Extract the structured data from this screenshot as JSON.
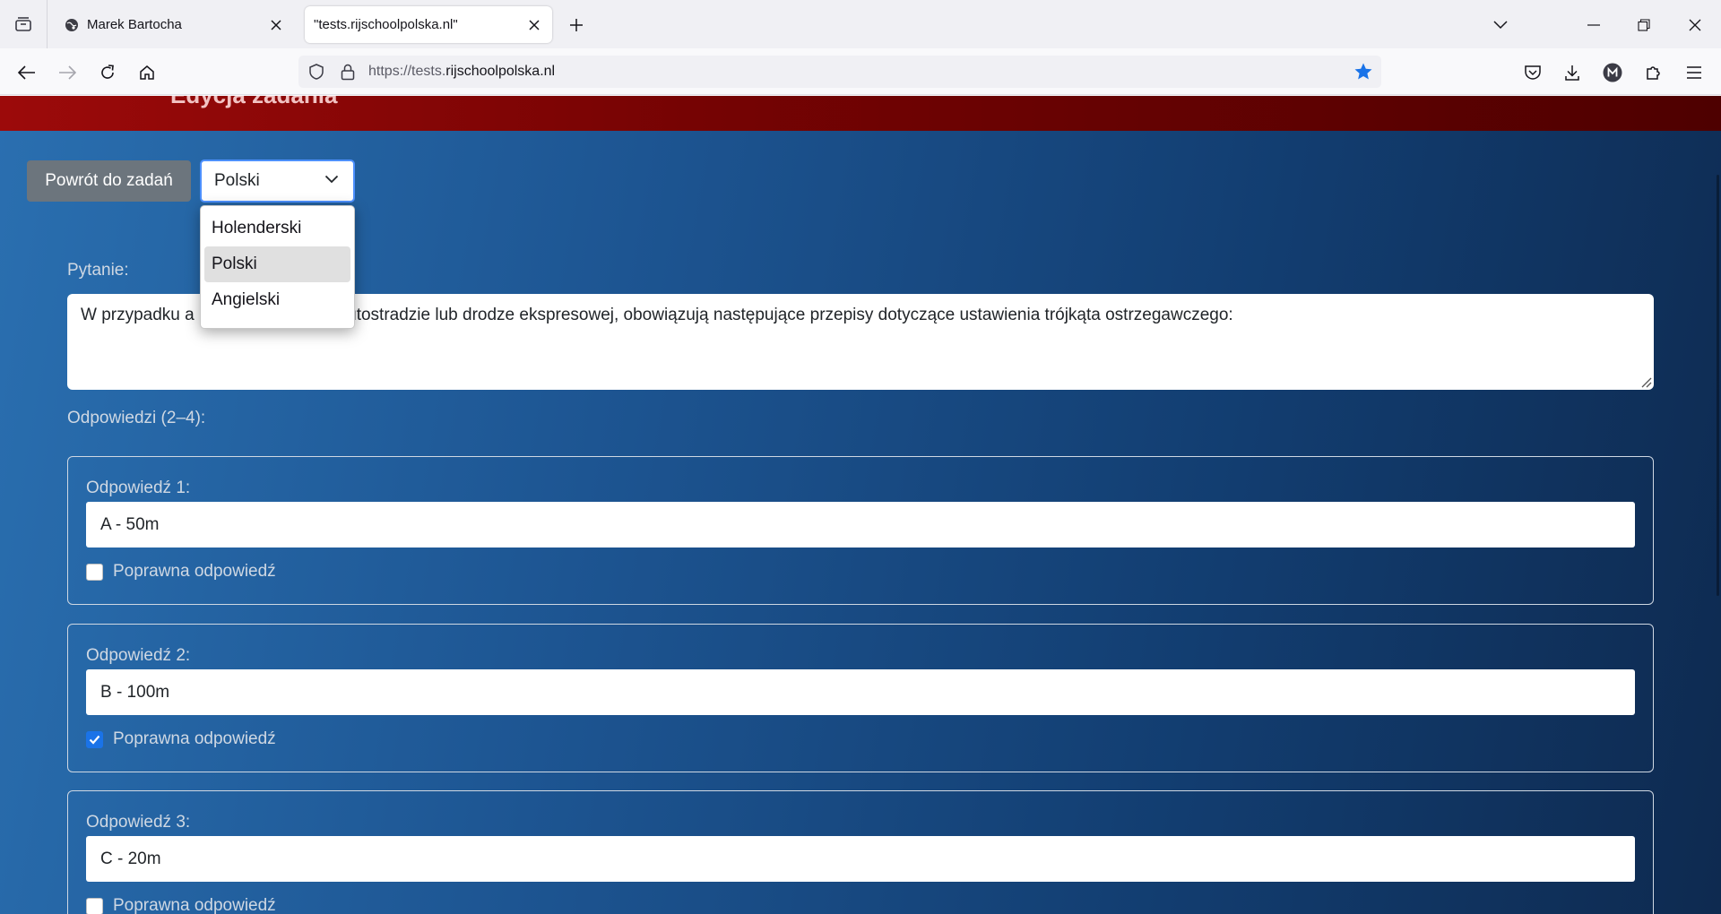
{
  "browser": {
    "tabs": [
      {
        "title": "Marek Bartocha",
        "active": false
      },
      {
        "title": "\"tests.rijschoolpolska.nl\"",
        "active": true
      }
    ],
    "url_prefix": "https://tests.",
    "url_host": "rijschoolpolska.nl",
    "accent_color": "#1a73e8"
  },
  "page": {
    "header_title": "Edycja zadania",
    "back_button": "Powrót do zadań",
    "language_select": {
      "value": "Polski",
      "options": [
        "Holenderski",
        "Polski",
        "Angielski"
      ],
      "selected_index": 1
    },
    "question_label": "Pytanie:",
    "question_visible_start": "W przypadku a",
    "question_visible_end": "a autostradzie lub drodze ekspresowej, obowiązują następujące przepisy dotyczące ustawienia trójkąta ostrzegawczego:",
    "answers_label": "Odpowiedzi (2–4):",
    "correct_label": "Poprawna odpowiedź",
    "answers": [
      {
        "label": "Odpowiedź 1:",
        "value": "A - 50m",
        "correct": false
      },
      {
        "label": "Odpowiedź 2:",
        "value": "B - 100m",
        "correct": true
      },
      {
        "label": "Odpowiedź 3:",
        "value": "C - 20m",
        "correct": false
      }
    ]
  }
}
